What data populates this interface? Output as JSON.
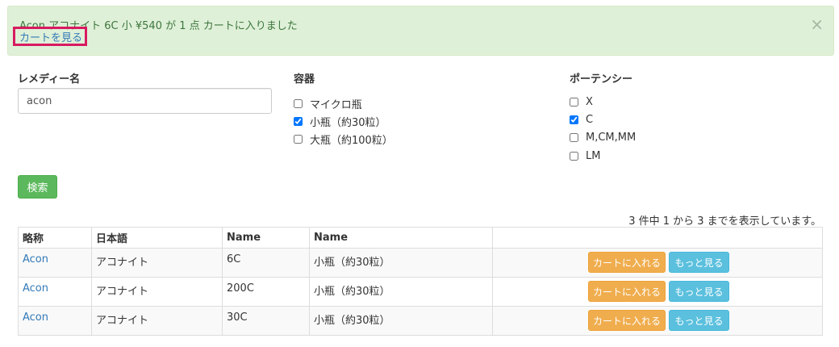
{
  "alert": {
    "message": "Acon アコナイト 6C 小 ¥540 が 1 点 カートに入りました",
    "cart_link": "カートを見る",
    "close": "×"
  },
  "form": {
    "remedy_label": "レメディー名",
    "remedy_value": "acon",
    "container_label": "容器",
    "containers": [
      {
        "label": "マイクロ瓶",
        "checked": false
      },
      {
        "label": "小瓶（約30粒）",
        "checked": true
      },
      {
        "label": "大瓶（約100粒）",
        "checked": false
      }
    ],
    "potency_label": "ポーテンシー",
    "potencies": [
      {
        "label": "X",
        "checked": false
      },
      {
        "label": "C",
        "checked": true
      },
      {
        "label": "M,CM,MM",
        "checked": false
      },
      {
        "label": "LM",
        "checked": false
      }
    ],
    "search_button": "検索"
  },
  "results": {
    "summary": "3 件中 1 から 3 までを表示しています。",
    "headers": [
      "略称",
      "日本語",
      "Name",
      "Name",
      ""
    ],
    "rows": [
      {
        "abbr": "Acon",
        "japanese": "アコナイト",
        "potency": "6C",
        "container": "小瓶（約30粒）"
      },
      {
        "abbr": "Acon",
        "japanese": "アコナイト",
        "potency": "200C",
        "container": "小瓶（約30粒）"
      },
      {
        "abbr": "Acon",
        "japanese": "アコナイト",
        "potency": "30C",
        "container": "小瓶（約30粒）"
      }
    ],
    "cart_button": "カートに入れる",
    "more_button": "もっと見る"
  }
}
